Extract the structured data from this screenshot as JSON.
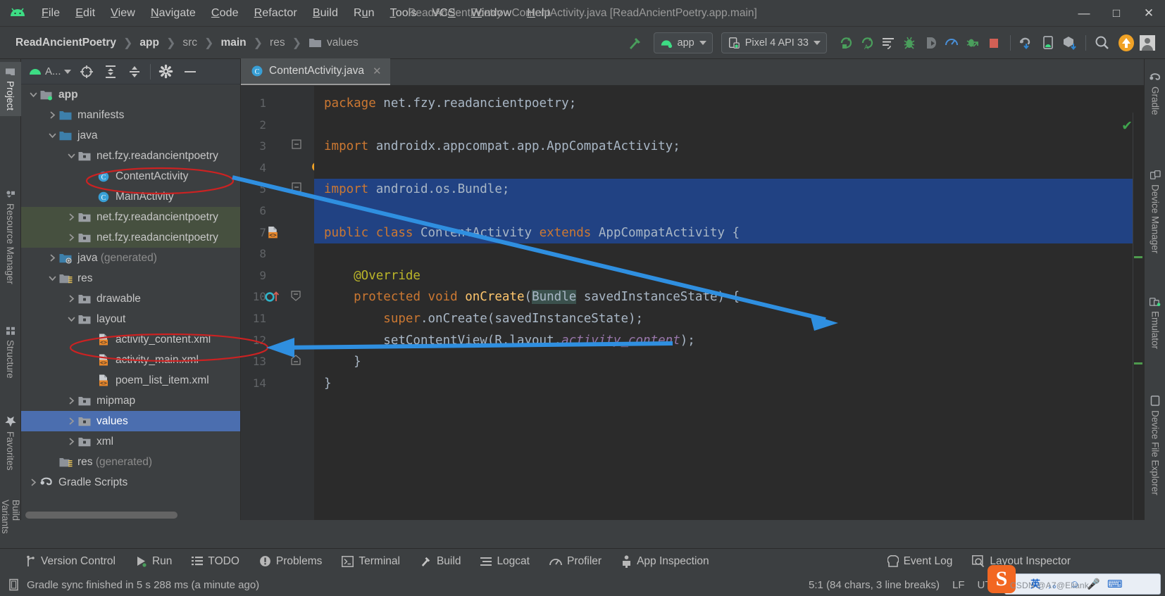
{
  "window": {
    "title": "ReadAncientPoetry - ContentActivity.java [ReadAncientPoetry.app.main]",
    "minimize": "—",
    "maximize": "□",
    "close": "✕"
  },
  "menu": [
    {
      "label": "File",
      "mnemonic": "F"
    },
    {
      "label": "Edit",
      "mnemonic": "E"
    },
    {
      "label": "View",
      "mnemonic": "V"
    },
    {
      "label": "Navigate",
      "mnemonic": "N"
    },
    {
      "label": "Code",
      "mnemonic": "C"
    },
    {
      "label": "Refactor",
      "mnemonic": "R"
    },
    {
      "label": "Build",
      "mnemonic": "B"
    },
    {
      "label": "Run",
      "mnemonic": "u"
    },
    {
      "label": "Tools",
      "mnemonic": "T"
    },
    {
      "label": "VCS",
      "mnemonic": "S"
    },
    {
      "label": "Window",
      "mnemonic": "W"
    },
    {
      "label": "Help",
      "mnemonic": "H"
    }
  ],
  "breadcrumbs": [
    {
      "label": "ReadAncientPoetry",
      "bold": true
    },
    {
      "label": "app",
      "bold": true
    },
    {
      "label": "src",
      "bold": false
    },
    {
      "label": "main",
      "bold": true
    },
    {
      "label": "res",
      "bold": false
    },
    {
      "label": "values",
      "bold": false,
      "folder": true
    }
  ],
  "toolbar": {
    "make_project_tooltip": "Make Project",
    "run_config": "app",
    "device": "Pixel 4 API 33",
    "icons": [
      "run-icon",
      "run-with-coverage-icon",
      "apply-changes-icon",
      "debug-icon",
      "attach-debugger-icon",
      "profiler-icon",
      "apply-code-changes-icon",
      "stop-icon",
      "gradle-sync-icon",
      "avd-manager-icon",
      "sdk-manager-icon",
      "search-everywhere-icon",
      "update-icon",
      "account-icon"
    ]
  },
  "left_strip": [
    {
      "label": "Project",
      "icon": "folder-icon",
      "selected": true
    },
    {
      "label": "Resource Manager",
      "icon": "resource-icon",
      "selected": false
    },
    {
      "label": "Structure",
      "icon": "structure-icon",
      "selected": false
    },
    {
      "label": "Favorites",
      "icon": "star-icon",
      "selected": false
    },
    {
      "label": "Build Variants",
      "icon": "variants-icon",
      "selected": false
    }
  ],
  "right_strip": [
    {
      "label": "Gradle",
      "icon": "gradle-elephant-icon"
    },
    {
      "label": "Device Manager",
      "icon": "device-manager-icon"
    },
    {
      "label": "Emulator",
      "icon": "emulator-icon"
    },
    {
      "label": "Device File Explorer",
      "icon": "device-file-explorer-icon"
    }
  ],
  "project_panel": {
    "view_selector": "A...",
    "toolbar_icons": [
      "select-opened-file-icon",
      "expand-all-icon",
      "collapse-all-icon",
      "settings-gear-icon",
      "hide-icon"
    ],
    "tree": [
      {
        "label": "app",
        "indent": 0,
        "arrow": "down",
        "icon": "module-icon",
        "bold": true,
        "state": "normal"
      },
      {
        "label": "manifests",
        "indent": 1,
        "arrow": "right",
        "icon": "folder-blue-icon",
        "bold": false,
        "state": "normal"
      },
      {
        "label": "java",
        "indent": 1,
        "arrow": "down",
        "icon": "folder-blue-icon",
        "bold": false,
        "state": "normal"
      },
      {
        "label": "net.fzy.readancientpoetry",
        "indent": 2,
        "arrow": "down",
        "icon": "package-icon",
        "bold": false,
        "state": "normal"
      },
      {
        "label": "ContentActivity",
        "indent": 3,
        "arrow": "none",
        "icon": "java-class-icon",
        "bold": false,
        "state": "normal",
        "circled": true
      },
      {
        "label": "MainActivity",
        "indent": 3,
        "arrow": "none",
        "icon": "java-class-icon",
        "bold": false,
        "state": "normal"
      },
      {
        "label": "net.fzy.readancientpoetry",
        "indent": 2,
        "arrow": "right",
        "icon": "package-icon",
        "bold": false,
        "state": "scopeA"
      },
      {
        "label": "net.fzy.readancientpoetry",
        "indent": 2,
        "arrow": "right",
        "icon": "package-icon",
        "bold": false,
        "state": "scopeA"
      },
      {
        "label": "java",
        "suffix": "(generated)",
        "indent": 1,
        "arrow": "right",
        "icon": "folder-generated-icon",
        "bold": false,
        "state": "normal"
      },
      {
        "label": "res",
        "indent": 1,
        "arrow": "down",
        "icon": "folder-res-icon",
        "bold": false,
        "state": "normal"
      },
      {
        "label": "drawable",
        "indent": 2,
        "arrow": "right",
        "icon": "package-icon",
        "bold": false,
        "state": "normal"
      },
      {
        "label": "layout",
        "indent": 2,
        "arrow": "down",
        "icon": "package-icon",
        "bold": false,
        "state": "normal"
      },
      {
        "label": "activity_content.xml",
        "indent": 3,
        "arrow": "none",
        "icon": "xml-layout-icon",
        "bold": false,
        "state": "normal",
        "circled": true
      },
      {
        "label": "activity_main.xml",
        "indent": 3,
        "arrow": "none",
        "icon": "xml-layout-icon",
        "bold": false,
        "state": "normal"
      },
      {
        "label": "poem_list_item.xml",
        "indent": 3,
        "arrow": "none",
        "icon": "xml-layout-icon",
        "bold": false,
        "state": "normal"
      },
      {
        "label": "mipmap",
        "indent": 2,
        "arrow": "right",
        "icon": "package-icon",
        "bold": false,
        "state": "normal"
      },
      {
        "label": "values",
        "indent": 2,
        "arrow": "right",
        "icon": "package-icon",
        "bold": false,
        "state": "selected"
      },
      {
        "label": "xml",
        "indent": 2,
        "arrow": "right",
        "icon": "package-icon",
        "bold": false,
        "state": "normal"
      },
      {
        "label": "res",
        "suffix": "(generated)",
        "indent": 1,
        "arrow": "none",
        "icon": "folder-res-icon",
        "bold": false,
        "state": "normal"
      },
      {
        "label": "Gradle Scripts",
        "indent": 0,
        "arrow": "right",
        "icon": "gradle-elephant-icon",
        "bold": false,
        "state": "normal"
      }
    ]
  },
  "editor": {
    "tab": {
      "label": "ContentActivity.java",
      "icon": "java-class-icon",
      "close": "✕"
    },
    "lines": [
      {
        "n": 1,
        "tokens": [
          {
            "t": "package",
            "c": "kw"
          },
          {
            "t": " net.fzy.readancientpoetry;",
            "c": ""
          }
        ]
      },
      {
        "n": 2,
        "tokens": []
      },
      {
        "n": 3,
        "tokens": [
          {
            "t": "import",
            "c": "kw"
          },
          {
            "t": " androidx.appcompat.app.AppCompatActivity;",
            "c": ""
          }
        ]
      },
      {
        "n": 4,
        "tokens": []
      },
      {
        "n": 5,
        "tokens": [
          {
            "t": "import",
            "c": "kw"
          },
          {
            "t": " android.os.Bundle;",
            "c": ""
          }
        ]
      },
      {
        "n": 6,
        "tokens": []
      },
      {
        "n": 7,
        "tokens": [
          {
            "t": "public",
            "c": "kw"
          },
          {
            "t": " ",
            "c": ""
          },
          {
            "t": "class",
            "c": "kw"
          },
          {
            "t": " ContentActivity ",
            "c": ""
          },
          {
            "t": "extends",
            "c": "kw"
          },
          {
            "t": " AppCompatActivity {",
            "c": ""
          }
        ]
      },
      {
        "n": 8,
        "tokens": []
      },
      {
        "n": 9,
        "tokens": [
          {
            "t": "    @Override",
            "c": "ann"
          }
        ]
      },
      {
        "n": 10,
        "tokens": [
          {
            "t": "    ",
            "c": ""
          },
          {
            "t": "protected",
            "c": "kw"
          },
          {
            "t": " ",
            "c": ""
          },
          {
            "t": "void",
            "c": "kw"
          },
          {
            "t": " ",
            "c": ""
          },
          {
            "t": "onCreate",
            "c": "fn"
          },
          {
            "t": "(",
            "c": ""
          },
          {
            "t": "Bundle",
            "c": "hl"
          },
          {
            "t": " savedInstanceState) {",
            "c": ""
          }
        ]
      },
      {
        "n": 11,
        "tokens": [
          {
            "t": "        ",
            "c": ""
          },
          {
            "t": "super",
            "c": "kw"
          },
          {
            "t": ".onCreate(savedInstanceState);",
            "c": ""
          }
        ]
      },
      {
        "n": 12,
        "tokens": [
          {
            "t": "        setContentView(R.layout.",
            "c": ""
          },
          {
            "t": "activity_content",
            "c": "fld"
          },
          {
            "t": ");",
            "c": ""
          }
        ]
      },
      {
        "n": 13,
        "tokens": [
          {
            "t": "    }",
            "c": ""
          }
        ]
      },
      {
        "n": 14,
        "tokens": [
          {
            "t": "}",
            "c": ""
          }
        ]
      }
    ],
    "selected_lines": [
      5,
      7
    ],
    "gutter_marks": [
      {
        "line": 4,
        "icon": "lightbulb-icon"
      },
      {
        "line": 7,
        "icon": "layout-resource-icon"
      },
      {
        "line": 10,
        "icon": "override-method-icon"
      }
    ],
    "inspection_status": "ok-checkmark"
  },
  "bottom_tools": [
    {
      "label": "Version Control",
      "icon": "branch-icon"
    },
    {
      "label": "Run",
      "icon": "run-icon"
    },
    {
      "label": "TODO",
      "icon": "todo-icon"
    },
    {
      "label": "Problems",
      "icon": "problems-icon"
    },
    {
      "label": "Terminal",
      "icon": "terminal-icon"
    },
    {
      "label": "Build",
      "icon": "build-hammer-icon"
    },
    {
      "label": "Logcat",
      "icon": "logcat-icon"
    },
    {
      "label": "Profiler",
      "icon": "profiler-icon"
    },
    {
      "label": "App Inspection",
      "icon": "app-inspection-icon"
    }
  ],
  "bottom_tools_right": [
    {
      "label": "Event Log",
      "icon": "event-log-icon"
    },
    {
      "label": "Layout Inspector",
      "icon": "layout-inspector-icon"
    }
  ],
  "status_bar": {
    "message": "Gradle sync finished in 5 s 288 ms (a minute ago)",
    "message_icon": "document-icon",
    "caret_position": "5:1 (84 chars, 3 line breaks)",
    "line_separator": "LF",
    "encoding": "UTF-8",
    "ime_badge": "S",
    "watermark": "CSDN @A7@Eliank"
  },
  "colors": {
    "accent_blue": "#3c8ce0",
    "selection_blue": "#214283",
    "tree_selection": "#4b6eaf",
    "annotation_red": "#cc2222",
    "keyword_orange": "#cc7832",
    "method_yellow": "#ffc66d",
    "field_purple": "#9876aa",
    "annotation_yellow": "#bbb529",
    "green": "#3ddc84"
  }
}
